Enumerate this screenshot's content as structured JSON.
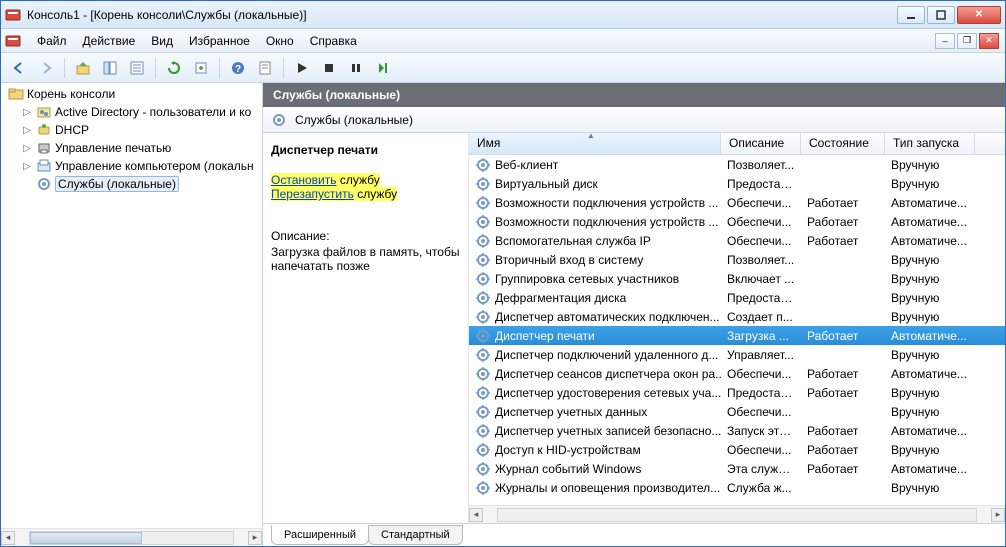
{
  "window": {
    "title": "Консоль1 - [Корень консоли\\Службы (локальные)]"
  },
  "menu": [
    "Файл",
    "Действие",
    "Вид",
    "Избранное",
    "Окно",
    "Справка"
  ],
  "tree": {
    "root": "Корень консоли",
    "items": [
      {
        "label": "Active Directory - пользователи и ко",
        "expandable": true
      },
      {
        "label": "DHCP",
        "expandable": true
      },
      {
        "label": "Управление печатью",
        "expandable": true
      },
      {
        "label": "Управление компьютером (локальн",
        "expandable": true
      },
      {
        "label": "Службы (локальные)",
        "expandable": false,
        "selected": true
      }
    ]
  },
  "rightHeader": "Службы (локальные)",
  "servicesSubheader": "Службы (локальные)",
  "detail": {
    "name": "Диспетчер печати",
    "stopAction": "Остановить",
    "stopSuffix": " службу",
    "restartAction": "Перезапустить",
    "restartSuffix": " службу",
    "descLabel": "Описание:",
    "descText": "Загрузка файлов в память, чтобы напечатать позже"
  },
  "columns": {
    "name": "Имя",
    "desc": "Описание",
    "state": "Состояние",
    "start": "Тип запуска"
  },
  "services": [
    {
      "name": "Веб-клиент",
      "desc": "Позволяет...",
      "state": "",
      "start": "Вручную"
    },
    {
      "name": "Виртуальный диск",
      "desc": "Предостав...",
      "state": "",
      "start": "Вручную"
    },
    {
      "name": "Возможности подключения устройств ...",
      "desc": "Обеспечи...",
      "state": "Работает",
      "start": "Автоматиче..."
    },
    {
      "name": "Возможности подключения устройств ...",
      "desc": "Обеспечи...",
      "state": "Работает",
      "start": "Автоматиче..."
    },
    {
      "name": "Вспомогательная служба IP",
      "desc": "Обеспечи...",
      "state": "Работает",
      "start": "Автоматиче..."
    },
    {
      "name": "Вторичный вход в систему",
      "desc": "Позволяет...",
      "state": "",
      "start": "Вручную"
    },
    {
      "name": "Группировка сетевых участников",
      "desc": "Включает ...",
      "state": "",
      "start": "Вручную"
    },
    {
      "name": "Дефрагментация диска",
      "desc": "Предостав...",
      "state": "",
      "start": "Вручную"
    },
    {
      "name": "Диспетчер автоматических подключен...",
      "desc": "Создает п...",
      "state": "",
      "start": "Вручную"
    },
    {
      "name": "Диспетчер печати",
      "desc": "Загрузка ...",
      "state": "Работает",
      "start": "Автоматиче...",
      "selected": true
    },
    {
      "name": "Диспетчер подключений удаленного д...",
      "desc": "Управляет...",
      "state": "",
      "start": "Вручную"
    },
    {
      "name": "Диспетчер сеансов диспетчера окон ра...",
      "desc": "Обеспечи...",
      "state": "Работает",
      "start": "Автоматиче..."
    },
    {
      "name": "Диспетчер удостоверения сетевых уча...",
      "desc": "Предостав...",
      "state": "Работает",
      "start": "Вручную"
    },
    {
      "name": "Диспетчер учетных данных",
      "desc": "Обеспечи...",
      "state": "",
      "start": "Вручную"
    },
    {
      "name": "Диспетчер учетных записей безопасно...",
      "desc": "Запуск это...",
      "state": "Работает",
      "start": "Автоматиче..."
    },
    {
      "name": "Доступ к HID-устройствам",
      "desc": "Обеспечи...",
      "state": "Работает",
      "start": "Вручную"
    },
    {
      "name": "Журнал событий Windows",
      "desc": "Эта служб...",
      "state": "Работает",
      "start": "Автоматиче..."
    },
    {
      "name": "Журналы и оповещения производител...",
      "desc": "Служба ж...",
      "state": "",
      "start": "Вручную"
    }
  ],
  "tabs": {
    "extended": "Расширенный",
    "standard": "Стандартный"
  }
}
